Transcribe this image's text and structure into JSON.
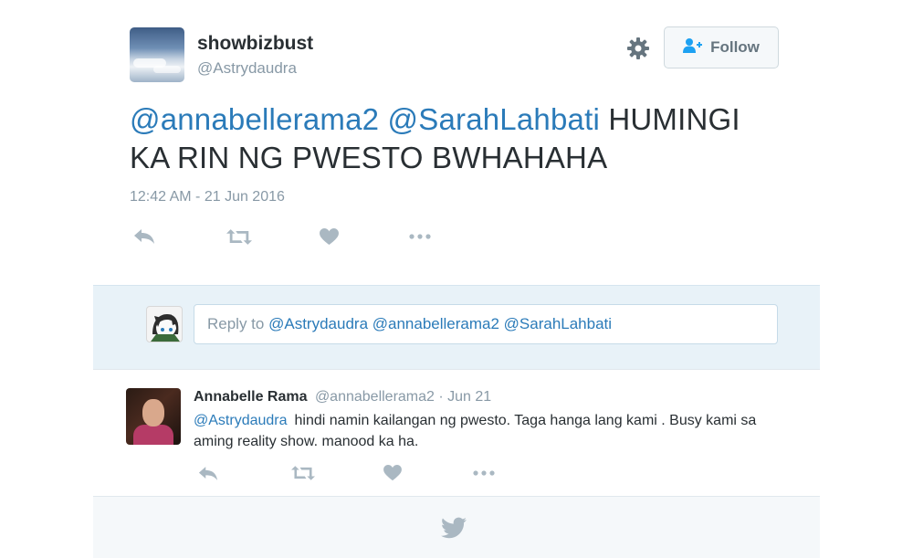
{
  "tweet": {
    "display_name": "showbizbust",
    "handle": "@Astrydaudra",
    "mention1": "@annabellerama2",
    "mention2": "@SarahLahbati",
    "text_line1": "HUMINGI",
    "text_line2": "KA RIN NG PWESTO BWHAHAHA",
    "timestamp": "12:42 AM - 21 Jun 2016",
    "follow_label": "Follow",
    "icons": {
      "settings": "gear-icon",
      "follow": "add-user-icon",
      "reply": "reply-icon",
      "retweet": "retweet-icon",
      "like": "heart-icon",
      "more": "more-icon"
    }
  },
  "composer": {
    "prefix": "Reply to",
    "mentions": "@Astrydaudra @annabellerama2 @SarahLahbati"
  },
  "reply": {
    "name": "Annabelle Rama",
    "meta": "@annabellerama2 · Jun 21",
    "mention": "@Astrydaudra",
    "text": "hindi namin kailangan ng pwesto. Taga hanga lang kami .  Busy kami sa aming reality show. manood ka ha."
  },
  "footer": {
    "icon": "twitter-bird-icon"
  },
  "colors": {
    "link": "#2b7bb9",
    "muted": "#8899a6",
    "composer_bg": "#e8f2f8",
    "footer_bg": "#f5f8fa"
  }
}
